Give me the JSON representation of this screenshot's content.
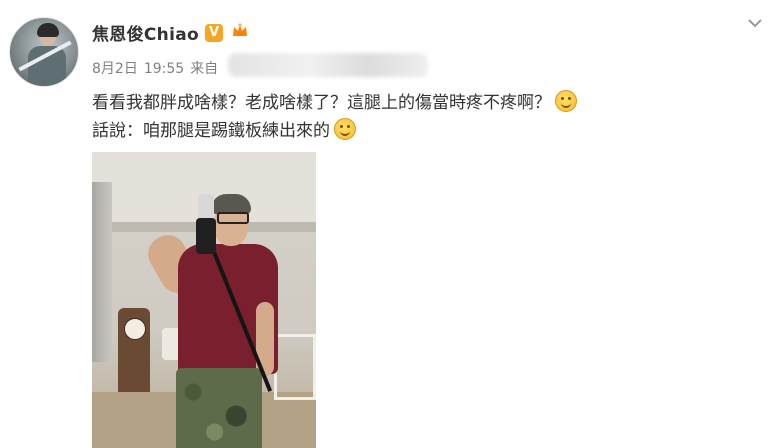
{
  "post": {
    "username": "焦恩俊Chiao",
    "verified_badge": "V",
    "meta": {
      "date": "8月2日",
      "time": "19:55",
      "source_prefix": "来自"
    },
    "lines": [
      "看看我都胖成啥樣？老成啥樣了？這腿上的傷當時疼不疼啊？",
      "話說：咱那腿是踢鐵板練出來的"
    ],
    "icons": {
      "menu": "chevron-down-icon",
      "verified": "verified-v-icon",
      "member": "member-crown-icon",
      "emoji_line1": "smile-emoji-icon",
      "emoji_line2": "grin-emoji-icon"
    },
    "colors": {
      "name": "#333333",
      "meta": "#808080",
      "verified_badge": "#f5a623",
      "member_badge": "#ff8200"
    }
  }
}
